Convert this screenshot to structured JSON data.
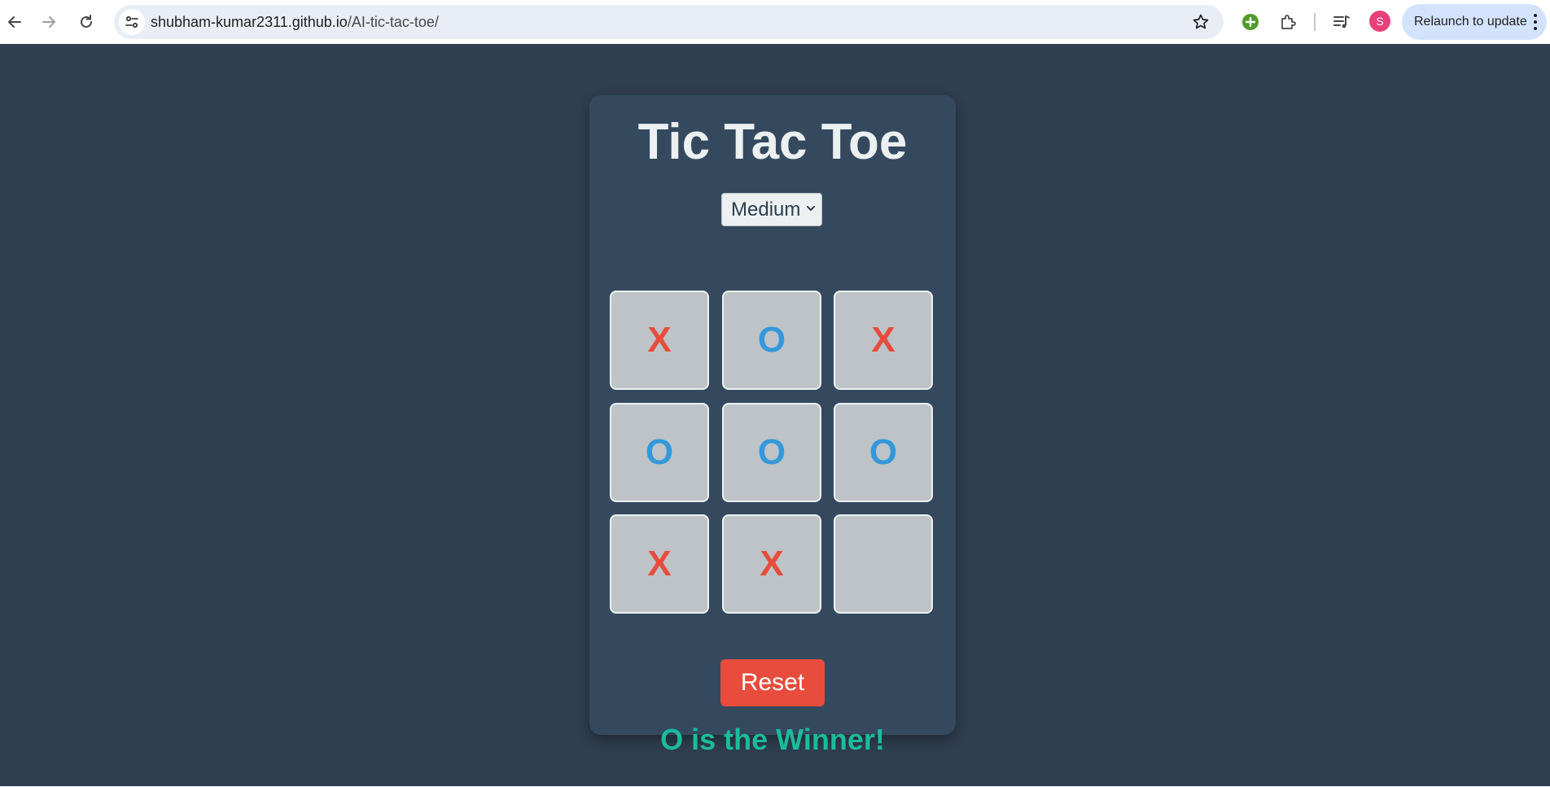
{
  "browser": {
    "url_host": "shubham-kumar2311.github.io",
    "url_path": "/AI-tic-tac-toe/",
    "relaunch_label": "Relaunch to update",
    "profile_initial": "S",
    "icons": [
      "back-icon",
      "forward-icon",
      "reload-icon",
      "site-info-icon",
      "bookmark-star-icon",
      "extension-add-icon",
      "extensions-puzzle-icon",
      "media-controls-icon",
      "kebab-menu-icon"
    ]
  },
  "game": {
    "title": "Tic Tac Toe",
    "difficulty": {
      "selected": "Medium"
    },
    "board": [
      [
        "X",
        "O",
        "X"
      ],
      [
        "O",
        "O",
        "O"
      ],
      [
        "X",
        "X",
        ""
      ]
    ],
    "reset_label": "Reset",
    "status": "O is the Winner!",
    "colors": {
      "x": "#e74c3c",
      "o": "#3498db",
      "status": "#1abc9c",
      "reset": "#e74c3c",
      "background": "#2f3e50",
      "card": "#34495e"
    }
  }
}
